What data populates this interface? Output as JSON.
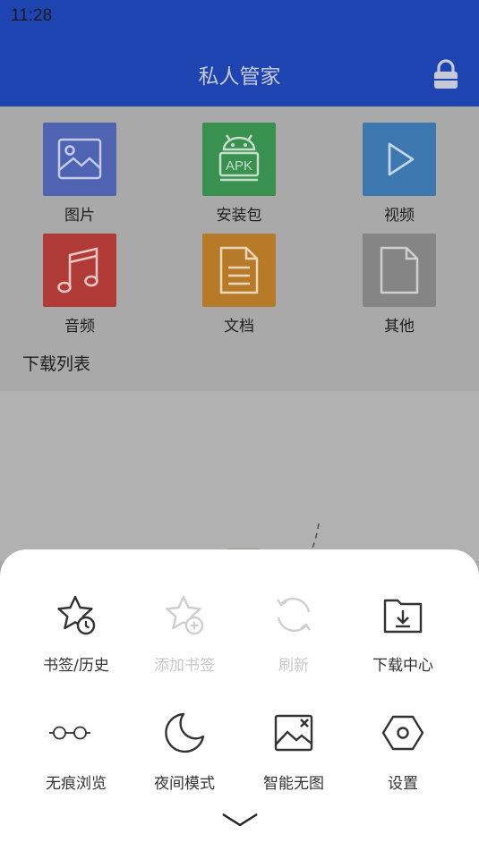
{
  "status_bar": {
    "time": "11:28"
  },
  "app_bar": {
    "title": "私人管家",
    "lock_icon": "lock-icon"
  },
  "categories": [
    {
      "label": "图片",
      "icon": "image-icon",
      "color": "#4e63b2"
    },
    {
      "label": "安装包",
      "icon": "apk-icon",
      "color": "#39914f"
    },
    {
      "label": "视频",
      "icon": "play-icon",
      "color": "#3c77b0"
    },
    {
      "label": "音频",
      "icon": "music-icon",
      "color": "#b03a35"
    },
    {
      "label": "文档",
      "icon": "document-icon",
      "color": "#b67a28"
    },
    {
      "label": "其他",
      "icon": "file-icon",
      "color": "#858585"
    }
  ],
  "download_list": {
    "title": "下载列表"
  },
  "menu": {
    "items": [
      {
        "label": "书签/历史",
        "icon": "bookmark-history-icon",
        "enabled": true
      },
      {
        "label": "添加书签",
        "icon": "add-bookmark-icon",
        "enabled": false
      },
      {
        "label": "刷新",
        "icon": "refresh-icon",
        "enabled": false
      },
      {
        "label": "下载中心",
        "icon": "download-folder-icon",
        "enabled": true
      },
      {
        "label": "无痕浏览",
        "icon": "incognito-glasses-icon",
        "enabled": true
      },
      {
        "label": "夜间模式",
        "icon": "moon-icon",
        "enabled": true
      },
      {
        "label": "智能无图",
        "icon": "no-image-icon",
        "enabled": true
      },
      {
        "label": "设置",
        "icon": "settings-hexagon-icon",
        "enabled": true
      }
    ],
    "collapse_icon": "chevron-down-icon"
  }
}
